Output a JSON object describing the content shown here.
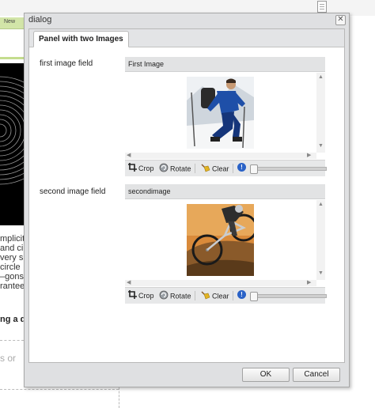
{
  "dialog": {
    "title": "dialog",
    "close_glyph": "✕",
    "tab_label": "Panel with two Images"
  },
  "fields": [
    {
      "label": "first image field",
      "header": "First Image",
      "image_icon": "hiker-photo",
      "toolbar": {
        "crop": "Crop",
        "rotate": "Rotate",
        "clear": "Clear"
      },
      "zoom_level": 0.0
    },
    {
      "label": "second image field",
      "header": "secondimage",
      "image_icon": "mountain-bike-photo",
      "toolbar": {
        "crop": "Crop",
        "rotate": "Rotate",
        "clear": "Clear"
      },
      "zoom_level": 0.0
    }
  ],
  "footer": {
    "ok_label": "OK",
    "cancel_label": "Cancel"
  },
  "background_page": {
    "menu_text": "New",
    "text_lines": [
      "mplicit",
      "and cir",
      "very si",
      "circle",
      "–gons",
      "rantee"
    ],
    "bold_text": "ng a d",
    "faded_text": "s or"
  },
  "colors": {
    "accent": "#2a62c7",
    "tab_strip": "#e3e4e6",
    "dialog_frame": "#dfe0e2",
    "menu_bar": "#d2e5a8"
  }
}
